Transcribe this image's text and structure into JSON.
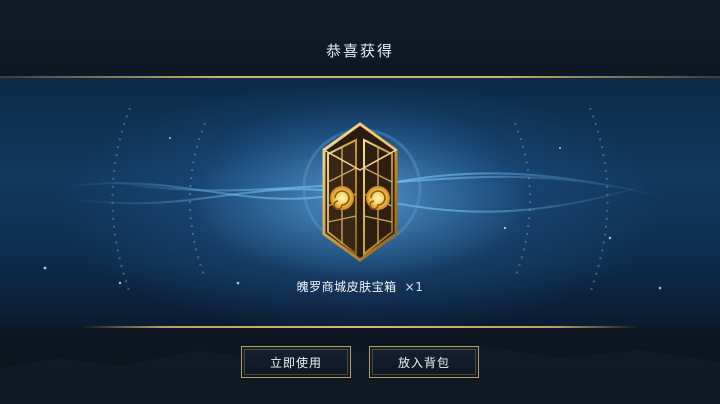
{
  "dialog": {
    "title": "恭喜获得"
  },
  "reward": {
    "item_name": "魄罗商城皮肤宝箱",
    "quantity": "×1",
    "icon": "treasure-chest-icon"
  },
  "buttons": {
    "use_now": "立即使用",
    "put_in_bag": "放入背包"
  },
  "colors": {
    "accent_gold": "#c9ae72",
    "glow_blue": "#5faae6",
    "text": "#e9eef5"
  }
}
